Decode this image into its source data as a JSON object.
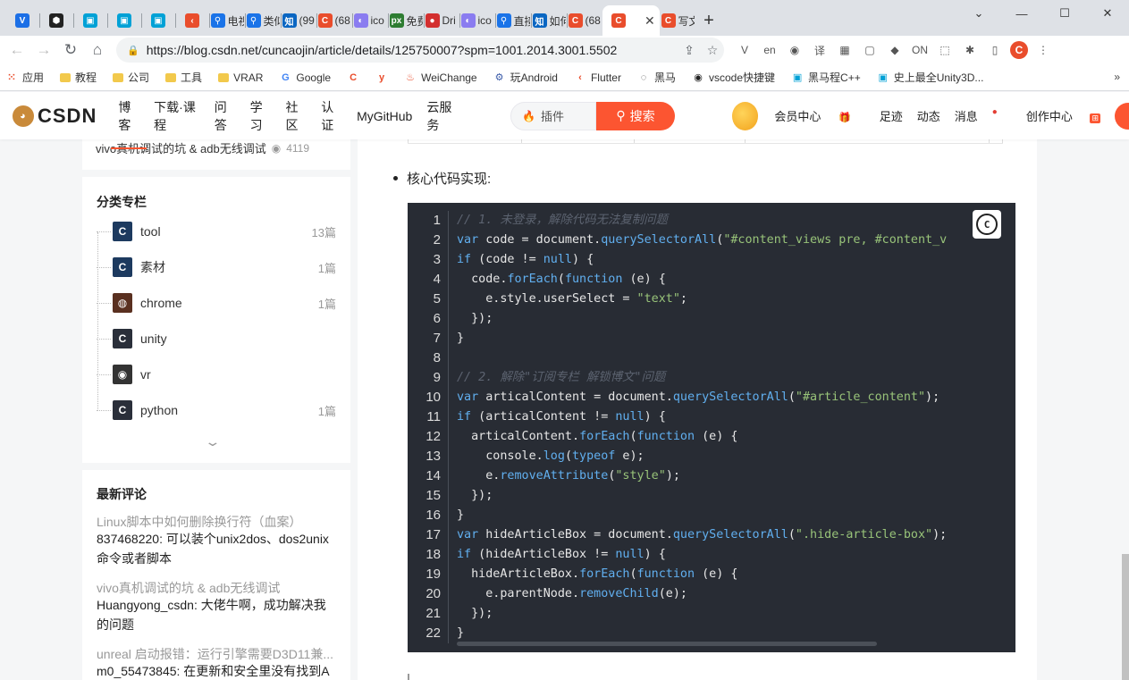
{
  "browser": {
    "tabs": [
      {
        "icon": "v-icon",
        "glyph": "V",
        "color": "#1c6fe6",
        "title": ""
      },
      {
        "icon": "unity-icon",
        "glyph": "⬢",
        "color": "#222222",
        "title": ""
      },
      {
        "icon": "bilibili-icon",
        "glyph": "▣",
        "color": "#00a1d6",
        "title": ""
      },
      {
        "icon": "bilibili-icon",
        "glyph": "▣",
        "color": "#00a1d6",
        "title": ""
      },
      {
        "icon": "bilibili-icon",
        "glyph": "▣",
        "color": "#00a1d6",
        "title": ""
      },
      {
        "icon": "flutter-icon",
        "glyph": "‹",
        "color": "#e94d2c",
        "title": ""
      },
      {
        "icon": "search-icon",
        "glyph": "⚲",
        "color": "#1a73e8",
        "title": "电视"
      },
      {
        "icon": "search-icon",
        "glyph": "⚲",
        "color": "#1a73e8",
        "title": "类似"
      },
      {
        "icon": "zhihu-icon",
        "glyph": "知",
        "color": "#0a66c2",
        "title": "(99"
      },
      {
        "icon": "csdn-icon",
        "glyph": "C",
        "color": "#e94d2c",
        "title": "(68"
      },
      {
        "icon": "iconfont-icon",
        "glyph": "◐",
        "color": "#8a7cf0",
        "title": "ico"
      },
      {
        "icon": "px-icon",
        "glyph": "px",
        "color": "#2e7d32",
        "title": "免费"
      },
      {
        "icon": "dribbble-icon",
        "glyph": "●",
        "color": "#d32f2f",
        "title": "Dri"
      },
      {
        "icon": "iconfont-icon",
        "glyph": "◐",
        "color": "#8a7cf0",
        "title": "ico"
      },
      {
        "icon": "search-icon",
        "glyph": "⚲",
        "color": "#1a73e8",
        "title": "直接"
      },
      {
        "icon": "zhihu-icon",
        "glyph": "知",
        "color": "#0a66c2",
        "title": "如何"
      },
      {
        "icon": "csdn-icon",
        "glyph": "C",
        "color": "#e94d2c",
        "title": "(68"
      }
    ],
    "active_tab": {
      "glyph": "C",
      "close": "✕"
    },
    "after_tab": {
      "glyph": "C",
      "title": "写文"
    },
    "new_tab": "+",
    "window": {
      "minimize": "—",
      "maximize": "☐",
      "close": "✕",
      "collapse": "⌄"
    },
    "nav": {
      "back": "←",
      "forward": "→",
      "reload": "↻",
      "home": "⌂"
    },
    "url": "https://blog.csdn.net/cuncaojin/article/details/125750007?spm=1001.2014.3001.5502",
    "extensions": [
      "V",
      "en",
      "◉",
      "译",
      "▦",
      "▢",
      "◆",
      "ON",
      "⬚",
      "✱",
      "▯",
      "C",
      "⋮"
    ],
    "bookmarks": [
      {
        "label": "应用",
        "kind": "apps"
      },
      {
        "label": "教程",
        "kind": "folder"
      },
      {
        "label": "公司",
        "kind": "folder"
      },
      {
        "label": "工具",
        "kind": "folder"
      },
      {
        "label": "VRAR",
        "kind": "folder"
      },
      {
        "label": "Google",
        "kind": "google"
      },
      {
        "label": "",
        "kind": "csdn"
      },
      {
        "label": "",
        "kind": "y"
      },
      {
        "label": "WeiChange",
        "kind": "fire"
      },
      {
        "label": "玩Android",
        "kind": "android"
      },
      {
        "label": "Flutter",
        "kind": "flutter"
      },
      {
        "label": "黑马",
        "kind": "circle"
      },
      {
        "label": "vscode快捷键",
        "kind": "github"
      },
      {
        "label": "黑马程C++",
        "kind": "bili"
      },
      {
        "label": "史上最全Unity3D...",
        "kind": "bili"
      }
    ],
    "bookmarks_more": "»"
  },
  "csdn": {
    "logo": "CSDN",
    "nav": [
      "博客",
      "下载·课程",
      "问答",
      "学习",
      "社区",
      "认证",
      "MyGitHub",
      "云服务"
    ],
    "search_placeholder": "插件",
    "search_button": "搜索",
    "user_nav": {
      "vip": "会员中心",
      "footprint": "足迹",
      "dynamic": "动态",
      "messages": "消息",
      "create": "创作中心"
    }
  },
  "sidebar": {
    "prev_article": {
      "title": "vivo真机调试的坑 & adb无线调试",
      "views": "4119"
    },
    "categories_title": "分类专栏",
    "categories": [
      {
        "name": "tool",
        "count": "13篇",
        "color": "#1d3a5f",
        "glyph": "C"
      },
      {
        "name": "素材",
        "count": "1篇",
        "color": "#1d3a5f",
        "glyph": "C"
      },
      {
        "name": "chrome",
        "count": "1篇",
        "color": "#5a3020",
        "glyph": "◍"
      },
      {
        "name": "unity",
        "count": "",
        "color": "#2a2f3a",
        "glyph": "C"
      },
      {
        "name": "vr",
        "count": "",
        "color": "#333333",
        "glyph": "◉"
      },
      {
        "name": "python",
        "count": "1篇",
        "color": "#2a2f3a",
        "glyph": "C"
      }
    ],
    "expand": "⌄",
    "comments_title": "最新评论",
    "comments": [
      {
        "article": "Linux脚本中如何删除换行符（血案）",
        "text": "837468220: 可以装个unix2dos、dos2unix命令或者脚本"
      },
      {
        "article": "vivo真机调试的坑 & adb无线调试",
        "text": "Huangyong_csdn: 大佬牛啊，成功解决我的问题"
      },
      {
        "article": "unreal 启动报错：运行引擎需要D3D11兼...",
        "text": "m0_55473845: 在更新和安全里没有找到A"
      }
    ]
  },
  "article": {
    "bullet": "核心代码实现:",
    "code_lines": [
      "// 1. 未登录，解除代码无法复制问题",
      "var code = document.querySelectorAll(\"#content_views pre, #content_v",
      "if (code != null) {",
      "  code.forEach(function (e) {",
      "    e.style.userSelect = \"text\";",
      "  });",
      "}",
      "",
      "// 2. 解除\"订阅专栏 解锁博文\"问题",
      "var articalContent = document.querySelectorAll(\"#article_content\");",
      "if (articalContent != null) {",
      "  articalContent.forEach(function (e) {",
      "    console.log(typeof e);",
      "    e.removeAttribute(\"style\");",
      "  });",
      "}",
      "var hideArticleBox = document.querySelectorAll(\".hide-article-box\");",
      "if (hideArticleBox != null) {",
      "  hideArticleBox.forEach(function (e) {",
      "    e.parentNode.removeChild(e);",
      "  });",
      "}"
    ],
    "copy_icon": "copy-icon",
    "code_colors": {
      "bg": "#282c34",
      "keyword": "#61afef",
      "string": "#98c379",
      "comment": "#5c6370"
    }
  }
}
